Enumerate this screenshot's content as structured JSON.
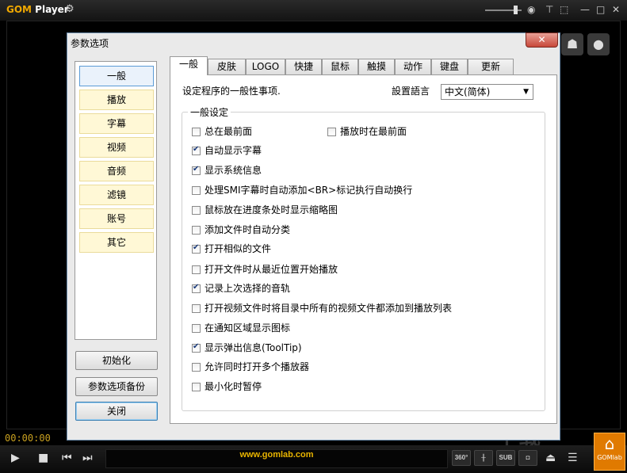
{
  "app": {
    "brand_prefix": "GOM",
    "brand_suffix": " Player",
    "url": "www.gomlab.com",
    "time": "00:00:00",
    "gomlab_label": "GOMlab"
  },
  "controls": {
    "btn_360": "360°",
    "btn_sub": "SUB"
  },
  "dialog": {
    "title": "参数选项",
    "close_glyph": "✕",
    "categories": [
      "一般",
      "播放",
      "字幕",
      "视频",
      "音频",
      "滤镜",
      "账号",
      "其它"
    ],
    "active_category": 0,
    "buttons": {
      "reset": "初始化",
      "backup": "参数选项备份",
      "close": "关闭"
    },
    "tabs": [
      "一般",
      "皮肤",
      "LOGO",
      "快捷",
      "鼠标",
      "触摸",
      "动作",
      "键盘",
      "更新"
    ],
    "active_tab": 0,
    "description": "设定程序的一般性事项.",
    "language_label": "設置語言",
    "language_value": "中文(简体)",
    "group_label": "一般设定",
    "options": [
      {
        "label": "总在最前面",
        "checked": false
      },
      {
        "label": "播放时在最前面",
        "checked": false
      },
      {
        "label": "自动显示字幕",
        "checked": true
      },
      {
        "label": "显示系统信息",
        "checked": true
      },
      {
        "label": "处理SMI字幕时自动添加<BR>标记执行自动换行",
        "checked": false
      },
      {
        "label": "鼠标放在进度条处时显示缩略图",
        "checked": false
      },
      {
        "label": "添加文件时自动分类",
        "checked": false
      },
      {
        "label": "打开相似的文件",
        "checked": true
      },
      {
        "label": "打开文件时从最近位置开始播放",
        "checked": false
      },
      {
        "label": "记录上次选择的音轨",
        "checked": true
      },
      {
        "label": "打开视频文件时将目录中所有的视频文件都添加到播放列表",
        "checked": false
      },
      {
        "label": "在通知区域显示图标",
        "checked": false
      },
      {
        "label": "显示弹出信息(ToolTip)",
        "checked": true
      },
      {
        "label": "允许同时打开多个播放器",
        "checked": false
      },
      {
        "label": "最小化时暂停",
        "checked": false
      }
    ]
  }
}
